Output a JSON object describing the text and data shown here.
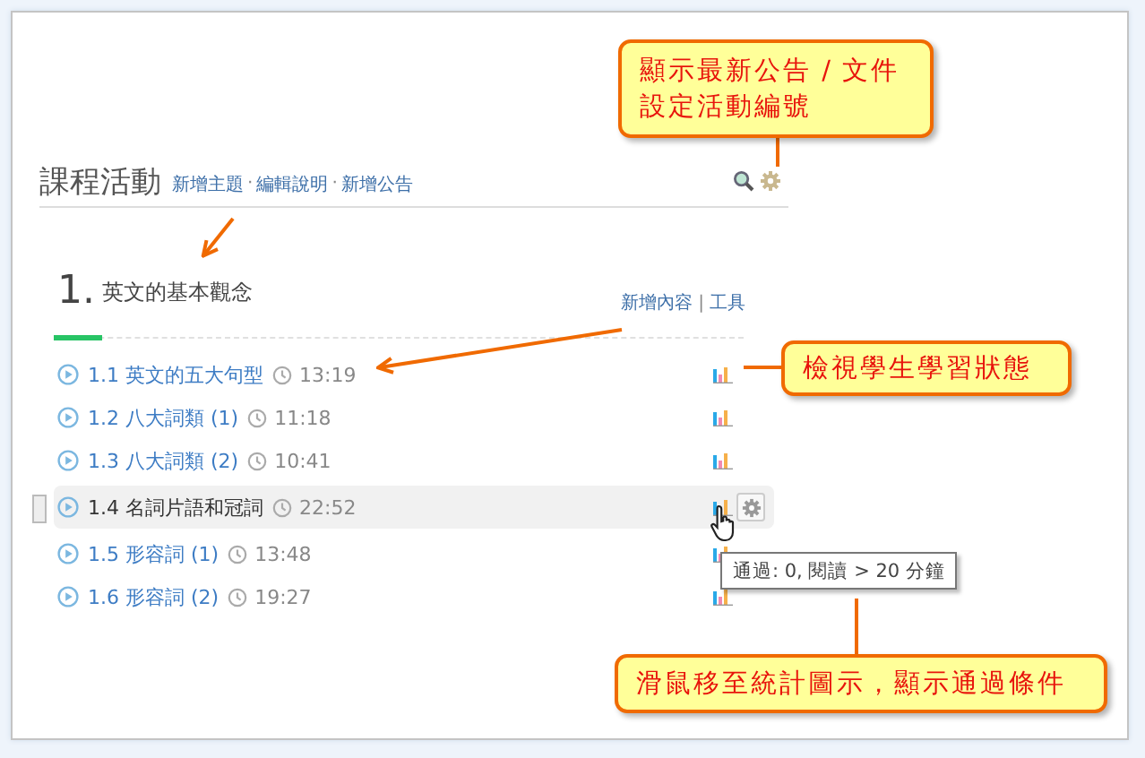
{
  "header": {
    "title": "課程活動",
    "separator": "·",
    "links": [
      "新增主題",
      "編輯說明",
      "新增公告"
    ]
  },
  "section": {
    "number": "1.",
    "title": "英文的基本觀念",
    "separator": "|",
    "actions": [
      "新增內容",
      "工具"
    ],
    "level": 0.07,
    "items": [
      {
        "label": "1.1 英文的五大句型",
        "duration": "13:19",
        "hovered": false
      },
      {
        "label": "1.2 八大詞類 (1)",
        "duration": "11:18",
        "hovered": false
      },
      {
        "label": "1.3 八大詞類 (2)",
        "duration": "10:41",
        "hovered": false
      },
      {
        "label": "1.4 名詞片語和冠詞",
        "duration": "22:52",
        "hovered": true
      },
      {
        "label": "1.5 形容詞 (1)",
        "duration": "13:48",
        "hovered": false
      },
      {
        "label": "1.6 形容詞 (2)",
        "duration": "19:27",
        "hovered": false
      }
    ]
  },
  "tooltip": "通過: 0, 閱讀 > 20 分鐘",
  "callouts": [
    {
      "lines": [
        "顯示最新公告 / 文件",
        "設定活動編號"
      ]
    },
    {
      "lines": [
        "檢視學生學習狀態"
      ]
    },
    {
      "lines": [
        "滑鼠移至統計圖示，顯示通過條件"
      ]
    }
  ]
}
